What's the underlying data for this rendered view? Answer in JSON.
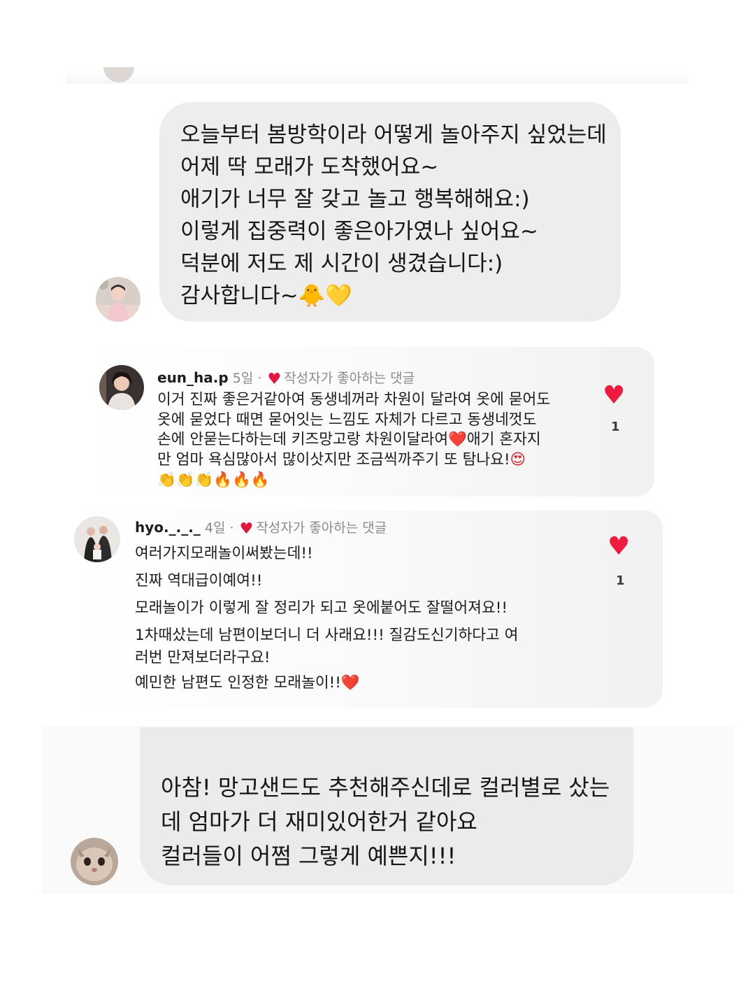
{
  "dm_message_1": {
    "lines": [
      "오늘부터 봄방학이라 어떻게 놀아주지 싶었는데",
      "어제 딱 모래가 도착했어요~",
      "애기가 너무 잘 갖고 놀고 행복해해요:)",
      "이렇게 집중력이 좋은아가였나 싶어요~",
      "덕분에 저도 제 시간이 생겼습니다:)",
      "감사합니다~"
    ],
    "emojis": [
      "🐥",
      "💛"
    ]
  },
  "comments": [
    {
      "username": "eun_ha.p",
      "time": "5일",
      "separator": "·",
      "author_liked_label": "작성자가 좋아하는 댓글",
      "body_lines": [
        "이거 진짜 좋은거같아여 동생네꺼라 차원이 달라여 옷에 묻어도",
        "옷에 묻었다 때면 묻어잇는 느낌도 자체가 다르고 동생네껏도",
        "손에 안묻는다하는데 키즈망고랑 차원이달라여",
        "만 엄마 욕심많아서 많이삿지만 조금씩까주기 또 탐나요!"
      ],
      "line3_tail": "애기 혼자지",
      "inline_emojis": [
        "❤️",
        "😍"
      ],
      "emoji_row": "👏👏👏🔥🔥🔥",
      "like_count": "1"
    },
    {
      "username": "hyo._._._",
      "time": "4일",
      "separator": "·",
      "author_liked_label": "작성자가 좋아하는 댓글",
      "body_lines": [
        "여러가지모래놀이써봤는데!!",
        "진짜 역대급이예여!!",
        "모래놀이가 이렇게 잘 정리가 되고 옷에붙어도 잘떨어져요!!",
        "1차때샀는데 남편이보더니 더 사래요!!! 질감도신기하다고 여",
        "러번 만져보더라구요!",
        "예민한 남편도 인정한 모래놀이!!"
      ],
      "trailing_emoji": "❤️",
      "like_count": "1"
    }
  ],
  "dm_message_2": {
    "lines": [
      "아참! 망고샌드도 추천해주신데로 컬러별로 샀는",
      "데 엄마가 더 재미있어한거 같아요",
      "컬러들이 어쩜 그렇게 예쁜지!!!"
    ]
  },
  "icons": {
    "like": "heart-icon",
    "author_liked": "heart-icon",
    "avatars": [
      "baby-avatar",
      "woman-avatar",
      "family-avatar",
      "cat-avatar"
    ]
  },
  "colors": {
    "bubble_bg": "#ededed",
    "like_heart": "#ef1b3f",
    "meta_text": "#8a8a8a"
  }
}
